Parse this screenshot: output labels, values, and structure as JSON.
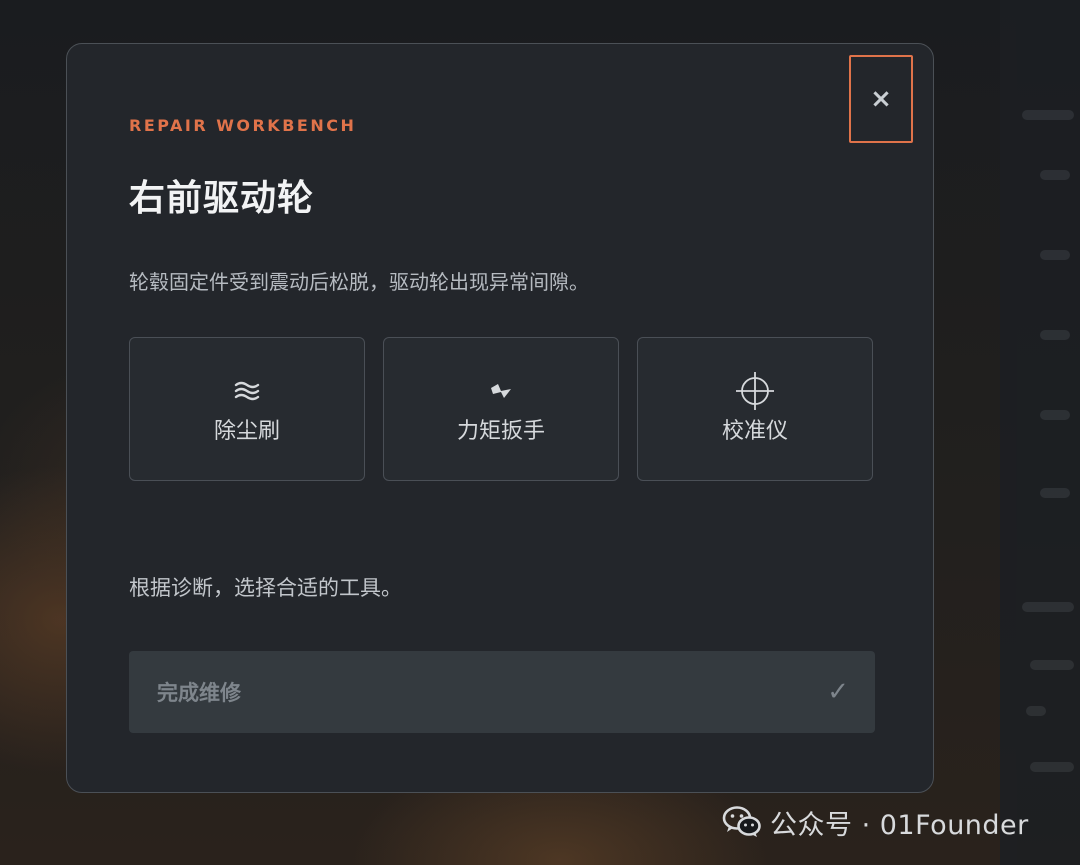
{
  "modal": {
    "eyebrow": "REPAIR WORKBENCH",
    "title": "右前驱动轮",
    "description": "轮毂固定件受到震动后松脱，驱动轮出现异常间隙。",
    "close_label": "×",
    "tools": [
      {
        "icon": "≋",
        "icon_name": "wave-icon",
        "label": "除尘刷"
      },
      {
        "icon": "⚡",
        "icon_name": "bolt-icon",
        "label": "力矩扳手"
      },
      {
        "icon": "⌖",
        "icon_name": "crosshair-icon",
        "label": "校准仪"
      }
    ],
    "hint": "根据诊断，选择合适的工具。",
    "complete_button": {
      "label": "完成维修",
      "check": "✓",
      "enabled": false
    }
  },
  "watermark": {
    "text": "公众号 · 01Founder",
    "icon_name": "wechat-logo-icon"
  },
  "colors": {
    "accent": "#e0734a",
    "modal_bg": "#23262b",
    "border": "#4b5056"
  }
}
